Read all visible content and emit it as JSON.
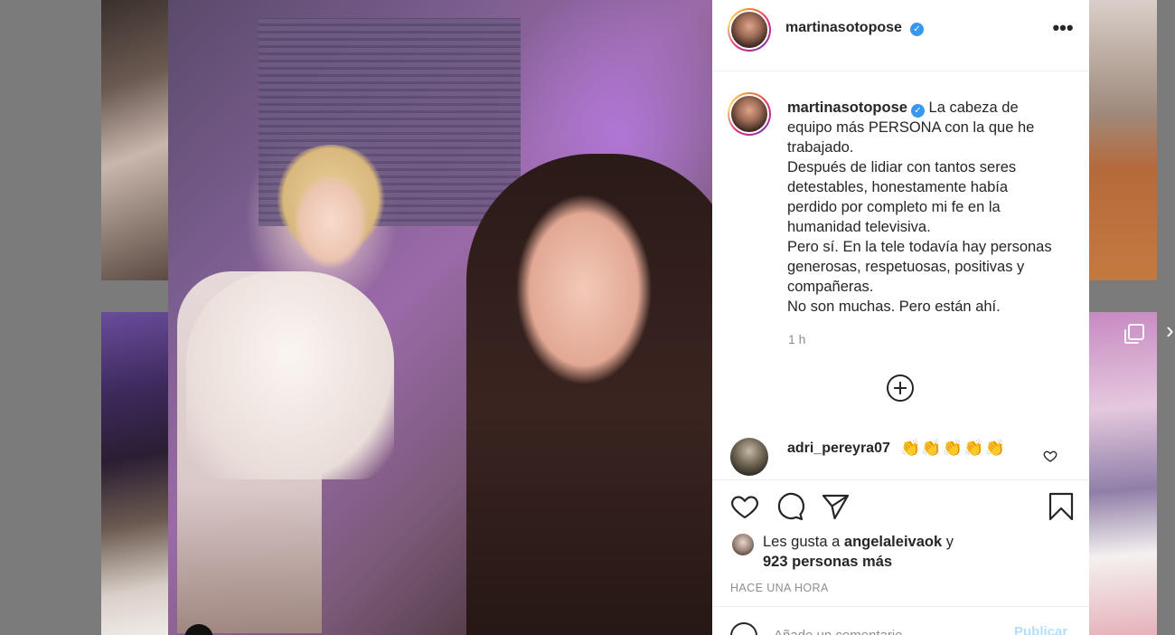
{
  "post": {
    "author": {
      "username": "martinasotopose",
      "verified_mark": "✓"
    },
    "caption": {
      "lines": [
        "La cabeza de",
        "equipo más PERSONA con la que he",
        "trabajado.",
        "Después de lidiar con tantos seres",
        "detestables, honestamente había",
        "perdido por completo mi fe en la",
        "humanidad televisiva.",
        "Pero sí. En la tele todavía hay personas",
        "generosas, respetuosas, positivas y",
        "compañeras.",
        "No son muchas. Pero están ahí."
      ],
      "relative_time": "1 h"
    },
    "comments": [
      {
        "username": "adri_pereyra07",
        "text": "👏👏👏👏👏"
      }
    ],
    "likes": {
      "prefix": "Les gusta a",
      "liker": "angelaleivaok",
      "suffix": "y",
      "others": "923 personas más"
    },
    "timestamp": "HACE UNA HORA",
    "comment_input": {
      "placeholder": "Añade un comentario...",
      "submit_label": "Publicar"
    }
  },
  "icons": {
    "more": "more-options-icon",
    "load_more": "plus-circle-icon",
    "like": "heart-icon",
    "comment": "comment-bubble-icon",
    "share": "paper-plane-icon",
    "save": "bookmark-icon",
    "emoji": "emoji-icon",
    "comment_like": "small-heart-icon"
  },
  "colors": {
    "verified_blue": "#3897f0",
    "text_primary": "#262626",
    "text_secondary": "#8e8e8e",
    "publish_disabled": "#b2dffc"
  }
}
